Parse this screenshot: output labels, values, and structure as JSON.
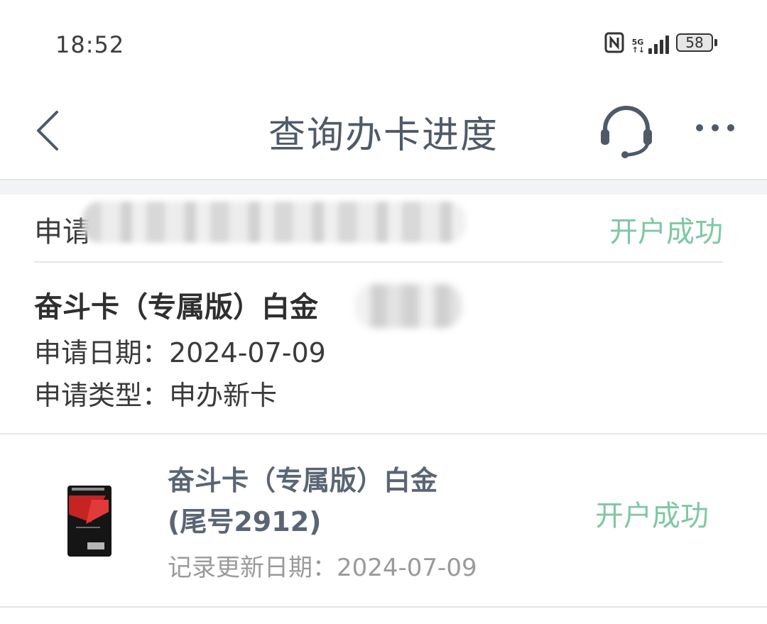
{
  "status_bar": {
    "time": "18:52",
    "network": "5G",
    "battery": "58"
  },
  "nav": {
    "title": "查询办卡进度"
  },
  "application": {
    "number_label": "申请",
    "status": "开户成功",
    "product_name": "奋斗卡（专属版）白金",
    "apply_date": "申请日期：2024-07-09",
    "apply_type": "申请类型：申办新卡"
  },
  "card": {
    "title_line1": "奋斗卡（专属版）白金",
    "title_line2": "(尾号2912)",
    "update_date": "记录更新日期：2024-07-09",
    "status": "开户成功"
  },
  "colors": {
    "accent_green": "#7fc7a3",
    "nav_text": "#4f5a68"
  }
}
